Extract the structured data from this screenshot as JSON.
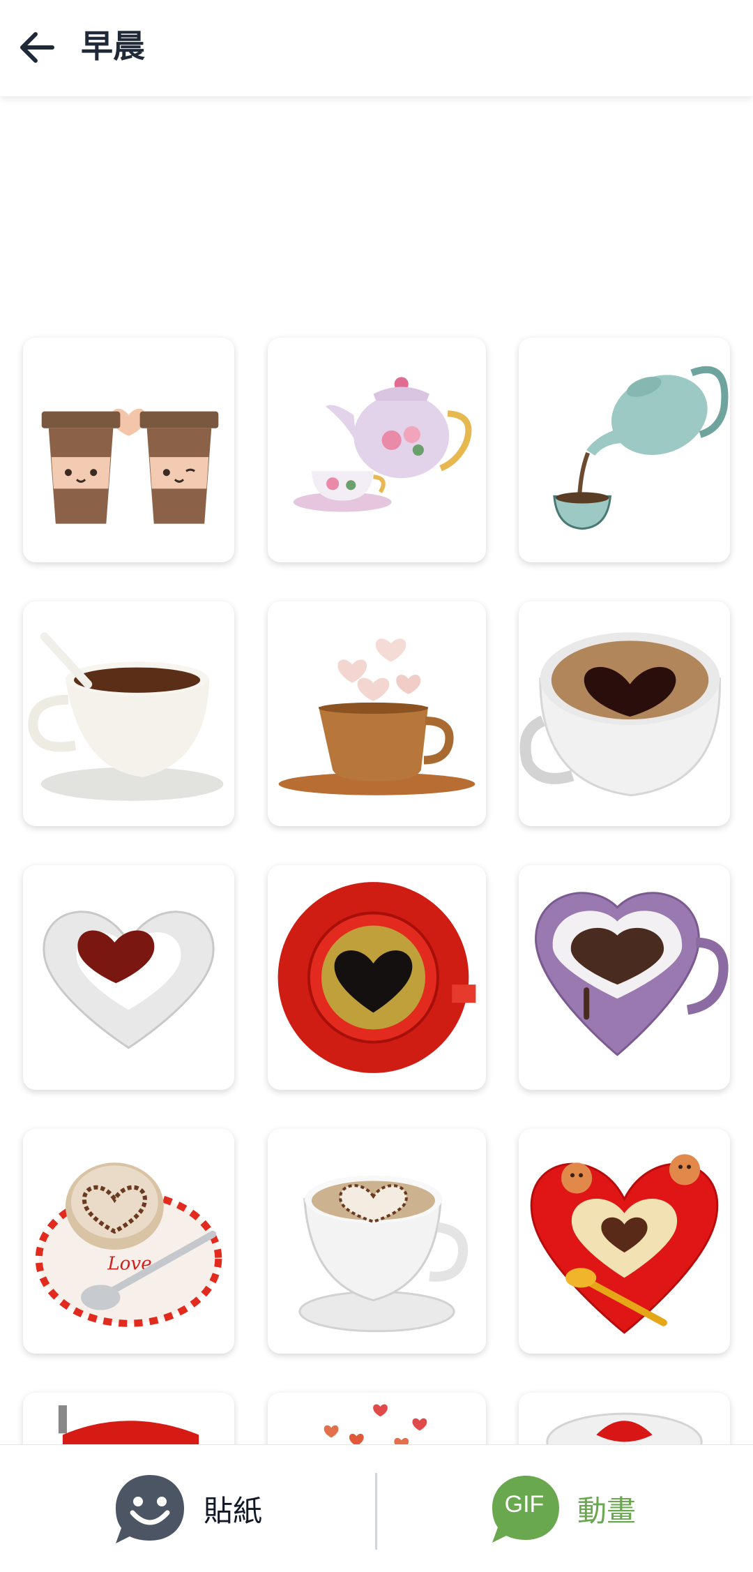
{
  "header": {
    "title": "早晨",
    "back_icon": "back-arrow-icon"
  },
  "stickers": [
    {
      "name": "sticker-coffee-cups-pair",
      "icon": "coffee-cups-pair-icon"
    },
    {
      "name": "sticker-floral-teapot",
      "icon": "floral-teapot-icon"
    },
    {
      "name": "sticker-teapot-pouring",
      "icon": "teapot-pouring-icon"
    },
    {
      "name": "sticker-white-coffee-cup",
      "icon": "white-coffee-cup-icon"
    },
    {
      "name": "sticker-steaming-copper-cup",
      "icon": "steaming-copper-cup-icon"
    },
    {
      "name": "sticker-heart-latte-cup",
      "icon": "heart-latte-cup-icon"
    },
    {
      "name": "sticker-white-heart-cup",
      "icon": "white-heart-cup-icon"
    },
    {
      "name": "sticker-red-heart-coffee",
      "icon": "red-heart-coffee-icon"
    },
    {
      "name": "sticker-purple-heart-mug",
      "icon": "purple-heart-mug-icon"
    },
    {
      "name": "sticker-love-cappuccino",
      "icon": "love-cappuccino-icon"
    },
    {
      "name": "sticker-latte-art-cup",
      "icon": "latte-art-cup-icon"
    },
    {
      "name": "sticker-gingerbread-heart-plate",
      "icon": "gingerbread-heart-plate-icon"
    }
  ],
  "bottom_tabs": {
    "stickers_label": "貼紙",
    "stickers_icon": "smiley-chat-icon",
    "gif_label": "動畫",
    "gif_badge": "GIF"
  },
  "colors": {
    "gif_green": "#6aa84f",
    "sticker_icon_gray": "#4b5563",
    "header_text": "#1f2937"
  }
}
